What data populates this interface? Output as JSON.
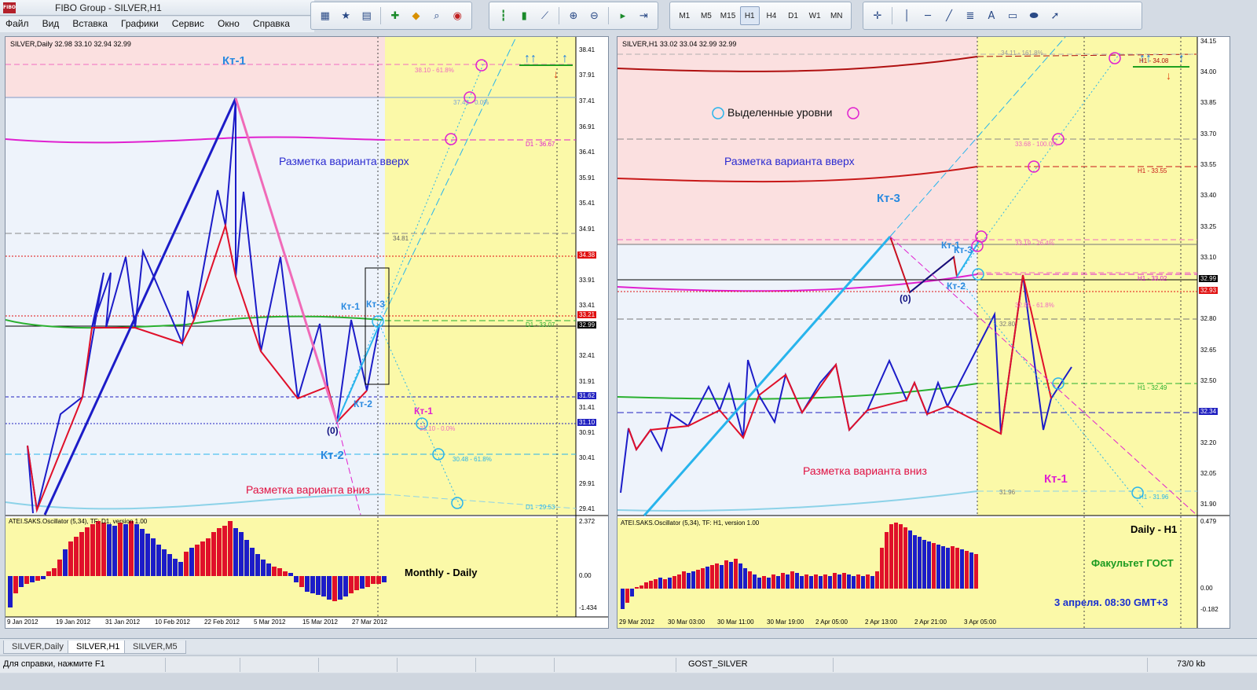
{
  "window": {
    "title": "FIBO Group - SILVER,H1",
    "icon_text": "FIBO"
  },
  "menu": [
    "Файл",
    "Вид",
    "Вставка",
    "Графики",
    "Сервис",
    "Окно",
    "Справка"
  ],
  "toolbar_icons": {
    "group1": [
      "new-chart-icon",
      "profiles-icon",
      "navigator-icon",
      "new-order-icon",
      "alert-icon",
      "search-icon",
      "options-icon"
    ],
    "group2": [
      "bar-chart-icon",
      "candles-icon",
      "line-chart-icon",
      "zoom-in-icon",
      "zoom-out-icon",
      "autoscroll-icon",
      "chart-shift-icon"
    ],
    "timeframes": [
      "M1",
      "M5",
      "M15",
      "H1",
      "H4",
      "D1",
      "W1",
      "MN"
    ],
    "active_timeframe": "H1",
    "group4": [
      "crosshair-icon",
      "vertical-line-icon",
      "horizontal-line-icon",
      "trendline-icon",
      "fibonacci-icon",
      "text-icon",
      "label-icon",
      "shapes-icon",
      "arrows-icon"
    ]
  },
  "left_chart": {
    "header": "SILVER,Daily  32.98 33.10 32.94 32.99",
    "oscillator_header": "ATEI.SAKS.Oscillator (5,34), TF: D1, version 1.00",
    "osc_scale": [
      "2.372",
      "0.00",
      "-1.434"
    ],
    "osc_caption": "Monthly - Daily",
    "price_scale": [
      "38.41",
      "37.91",
      "37.41",
      "36.91",
      "36.41",
      "35.91",
      "35.41",
      "34.91",
      "34.38",
      "33.91",
      "33.41",
      "33.21",
      "32.99",
      "32.41",
      "31.91",
      "31.62",
      "31.41",
      "31.10",
      "30.91",
      "30.41",
      "29.91",
      "29.41"
    ],
    "highlight_prices": {
      "red": "34.38",
      "red2": "33.21",
      "black": "32.99",
      "blue": "31.62",
      "blue2": "31.10"
    },
    "time_labels": [
      "9 Jan 2012",
      "19 Jan 2012",
      "31 Jan 2012",
      "10 Feb 2012",
      "22 Feb 2012",
      "5 Mar 2012",
      "15 Mar 2012",
      "27 Mar 2012"
    ],
    "labels": {
      "kt1_top": "Кт-1",
      "up_variant": "Разметка варианта вверх",
      "down_variant": "Разметка варианта вниз",
      "kt1": "Кт-1",
      "kt3": "Кт-3",
      "kt2": "Кт-2",
      "kt2_big": "Кт-2",
      "zero": "(0)",
      "kt1_magenta": "Кт-1",
      "lvl_3810": "38.10 - 61.8%",
      "lvl_3741": "37.41 - 0.0%",
      "lvl_d1_3667": "D1 - 36.67",
      "lvl_3481": "34.81",
      "lvl_d1_3307": "D1 - 33.07",
      "lvl_3110": "31.10 - 0.0%",
      "lvl_3048": "30.48 - 61.8%",
      "lvl_d1_2953": "D1 - 29.53"
    }
  },
  "right_chart": {
    "header": "SILVER,H1  33.02 33.04 32.99 32.99",
    "oscillator_header": "ATEI.SAKS.Oscillator (5,34), TF: H1, version 1.00",
    "osc_scale": [
      "0.479",
      "0.00",
      "-0.182"
    ],
    "osc_caption": "Daily - H1",
    "faculty": "Факультет ГОСТ",
    "date_note": "3 апреля. 08:30 GMT+3",
    "price_scale": [
      "34.15",
      "34.00",
      "33.85",
      "33.70",
      "33.55",
      "33.40",
      "33.25",
      "33.10",
      "32.99",
      "32.93",
      "32.80",
      "32.65",
      "32.50",
      "32.34",
      "32.20",
      "32.05",
      "31.90"
    ],
    "highlight_prices": {
      "black": "32.99",
      "red": "32.93",
      "blue": "32.34"
    },
    "time_labels": [
      "29 Mar 2012",
      "30 Mar 03:00",
      "30 Mar 11:00",
      "30 Mar 19:00",
      "2 Apr 05:00",
      "2 Apr 13:00",
      "2 Apr 21:00",
      "3 Apr 05:00"
    ],
    "labels": {
      "selected_levels": "Выделенные уровни",
      "up_variant": "Разметка варианта вверх",
      "down_variant": "Разметка варианта вниз",
      "kt3": "Кт-3",
      "kt1_blue": "Кт-1",
      "kt3_small": "Кт-3",
      "kt2": "Кт-2",
      "zero": "(0)",
      "kt1_magenta": "Кт-1",
      "lvl_3411": "34.11 - 161.8%",
      "lvl_h1_3408": "H1 - 34.08",
      "lvl_3368": "33.68 - 100.0%",
      "lvl_h1_3355": "H1 - 33.55",
      "lvl_3319": "33.19 - 26.4%",
      "lvl_h1_3302": "H1 - 33.02",
      "lvl_3289": "32.89 - 61.8%",
      "lvl_3280": "32.80",
      "lvl_h1_3249": "H1 - 32.49",
      "lvl_3196a": "31.96",
      "lvl_h1_3196": "H1 - 31.96"
    }
  },
  "tabs": [
    "SILVER,Daily",
    "SILVER,H1",
    "SILVER,M5"
  ],
  "active_tab": "SILVER,H1",
  "status": {
    "help": "Для справки, нажмите F1",
    "profile": "GOST_SILVER",
    "traffic": "73/0 kb"
  },
  "colors": {
    "chart_bg": "#ffffff",
    "up_zone": "#fbe0e0",
    "mid_zone": "#eef3fb",
    "future_zone": "#fbf9a8",
    "bull": "#1c1cc8",
    "bear": "#e0102a",
    "fibo_pink": "#f06ac0",
    "cyan": "#28b4ec"
  }
}
